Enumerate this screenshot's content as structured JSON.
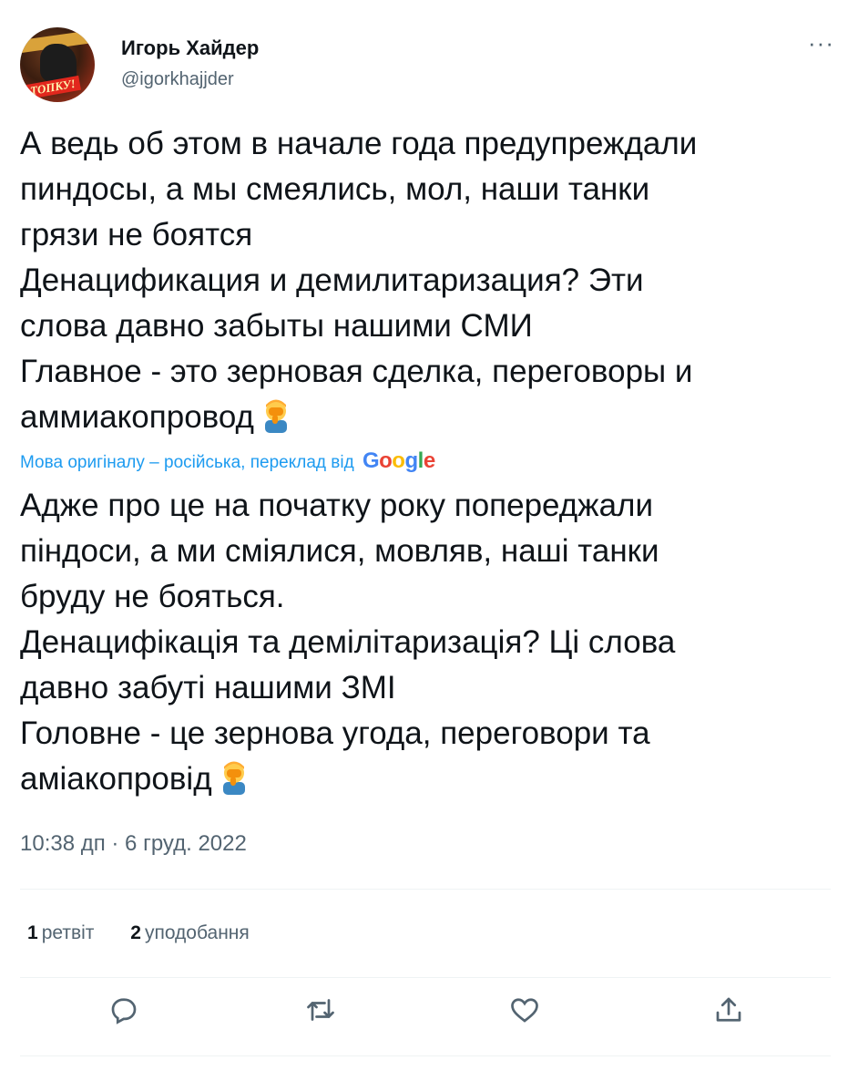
{
  "tweet": {
    "author": {
      "display_name": "Игорь Хайдер",
      "handle": "@igorkhajjder",
      "avatar_stamp": "ТОПКУ!"
    },
    "more_label": "···",
    "original_text": "А ведь об этом в начале года предупреждали\nпиндосы, а мы смеялись, мол, наши танки\nгрязи не боятся\nДенацификация и демилитаризация? Эти\nслова давно забыты нашими СМИ\nГлавное - это зерновая сделка, переговоры и\nаммиакопровод",
    "translation_note": "Мова оригіналу – російська, переклад від",
    "translation_provider": "Google",
    "translated_text": "Адже про це на початку року попереджали\nпіндоси, а ми сміялися, мовляв, наші танки\nбруду не бояться.\nДенацифікація та демілітаризація? Ці слова\nдавно забуті нашими ЗМІ\nГоловне - це зернова угода, переговори та\naміакопровід",
    "emoji": "facepalm-emoji",
    "timestamp": "10:38 дп · 6 груд. 2022",
    "stats": {
      "retweets_count": "1",
      "retweets_label": "ретвіт",
      "likes_count": "2",
      "likes_label": "уподобання"
    },
    "actions": [
      "reply-icon",
      "retweet-icon",
      "like-icon",
      "share-icon"
    ],
    "colors": {
      "text": "#0f1419",
      "secondary": "#536471",
      "link": "#1d9bf0",
      "divider": "#eff3f4"
    }
  }
}
